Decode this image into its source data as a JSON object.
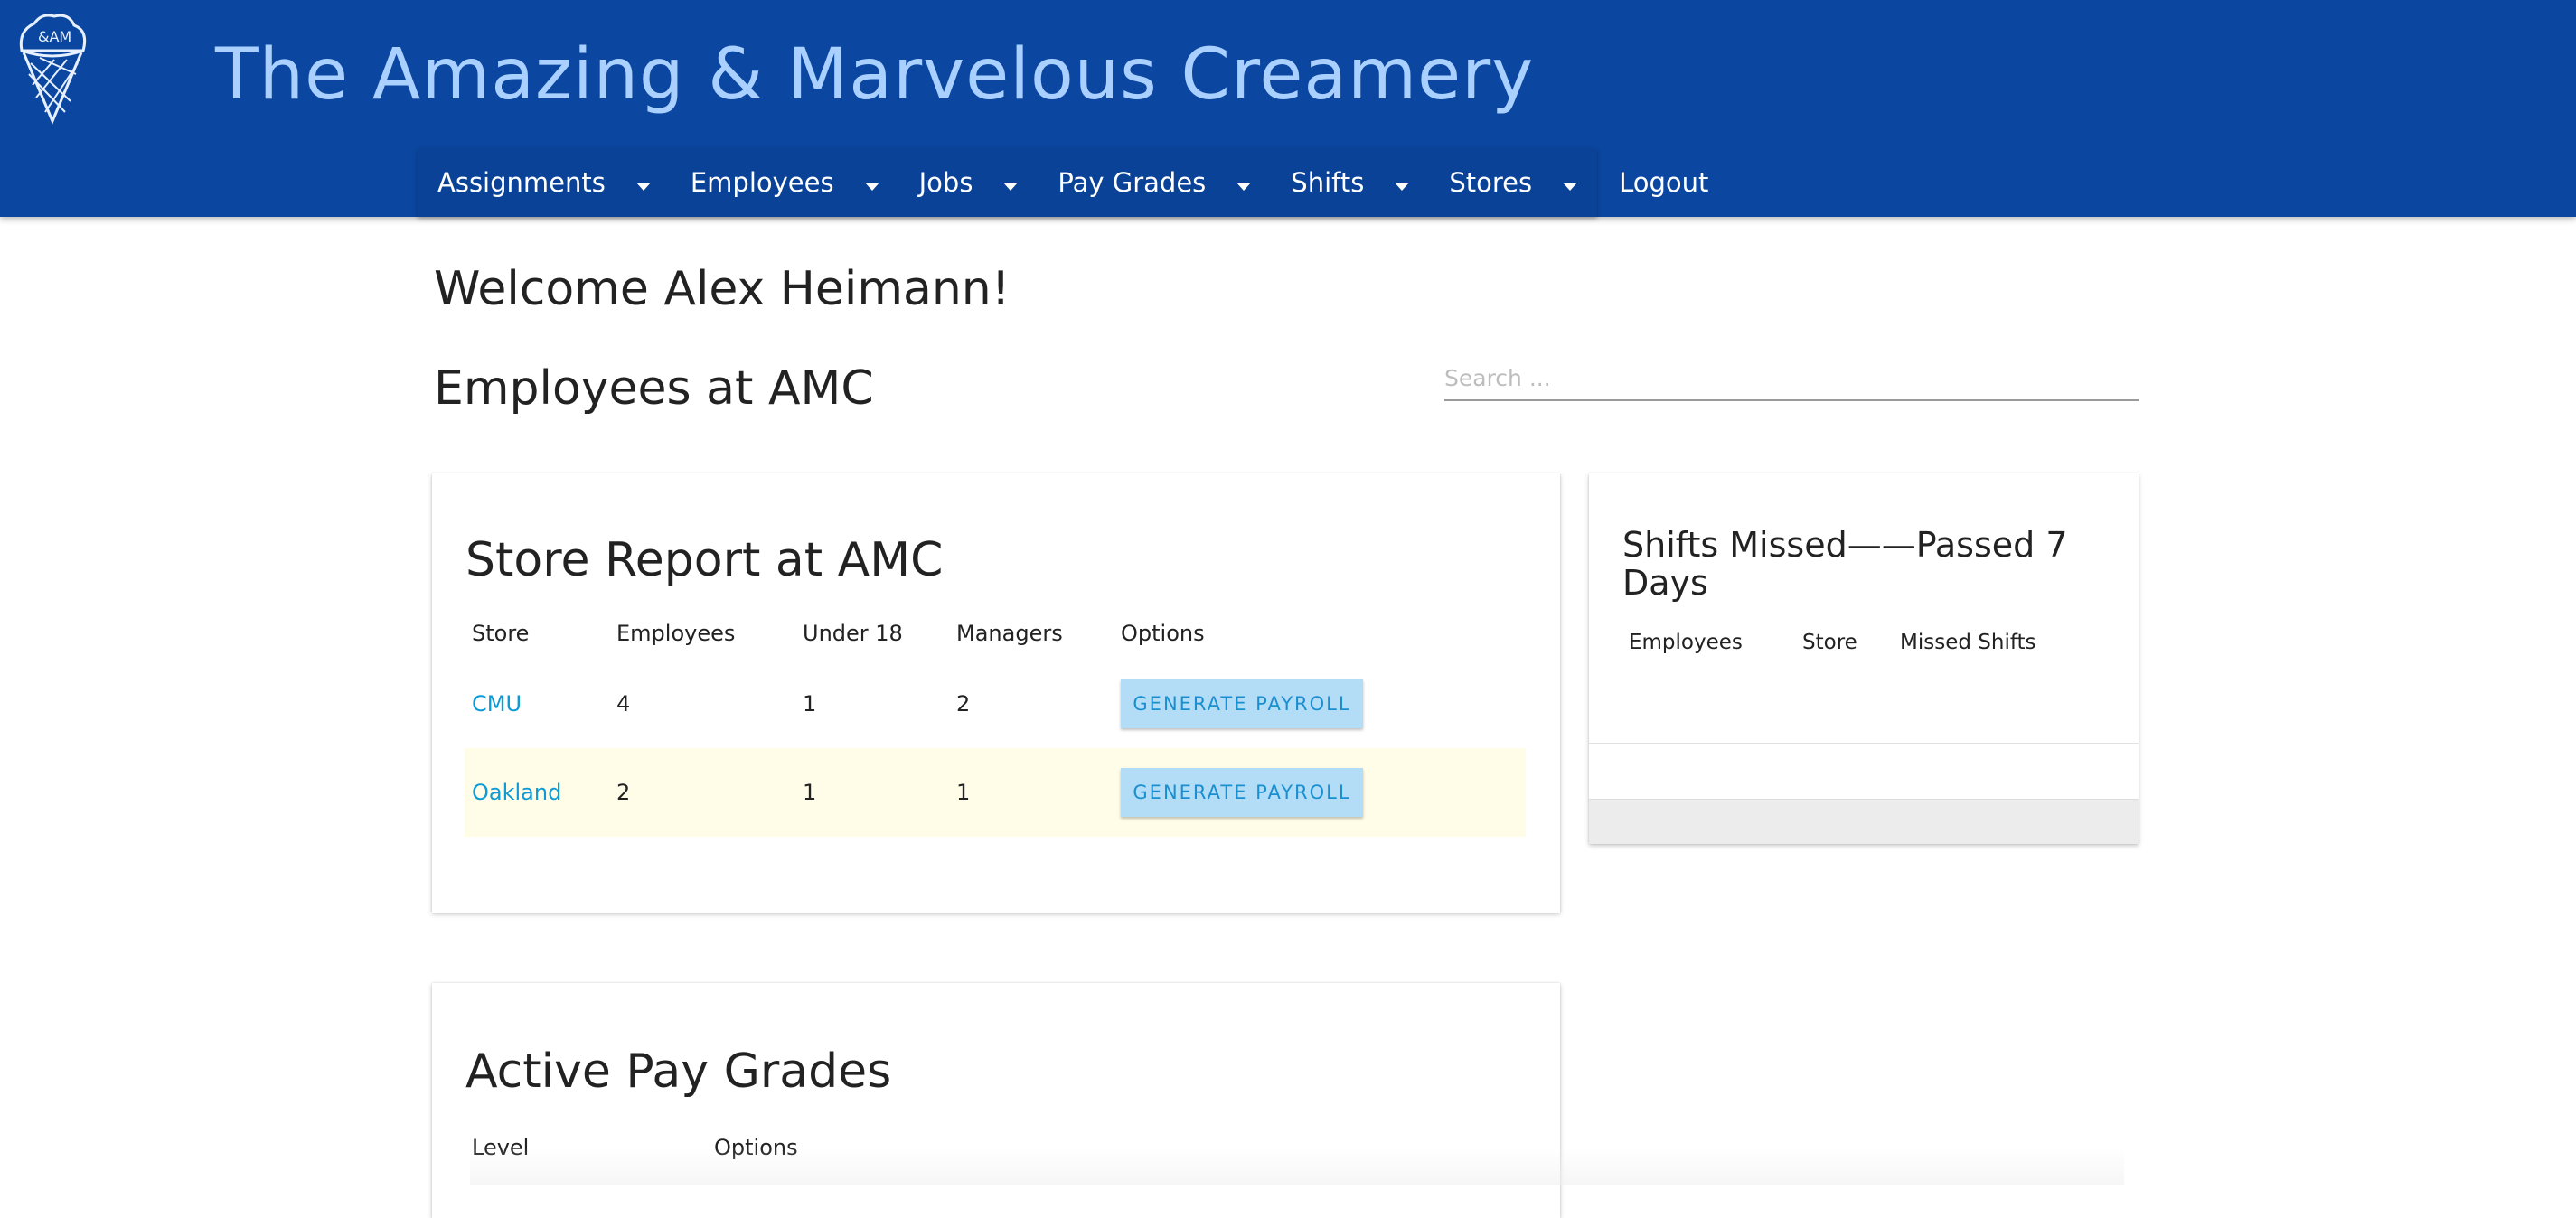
{
  "colors": {
    "brand": "#0b47a1",
    "title_text": "#a9d0ff",
    "link": "#0d9ad6",
    "button_bg": "#b3dcf6",
    "row_alt": "#fffde7"
  },
  "header": {
    "logo_icon": "ice-cream-cone-icon",
    "logo_text": "&AM",
    "title": "The Amazing & Marvelous Creamery"
  },
  "nav": {
    "items": [
      {
        "label": "Assignments",
        "dropdown": true
      },
      {
        "label": "Employees",
        "dropdown": true
      },
      {
        "label": "Jobs",
        "dropdown": true
      },
      {
        "label": "Pay Grades",
        "dropdown": true
      },
      {
        "label": "Shifts",
        "dropdown": true
      },
      {
        "label": "Stores",
        "dropdown": true
      }
    ],
    "logout": "Logout"
  },
  "main": {
    "welcome": "Welcome Alex Heimann!",
    "subtitle": "Employees at AMC",
    "search": {
      "placeholder": "Search ...",
      "value": ""
    }
  },
  "store_report": {
    "title": "Store Report at AMC",
    "columns": [
      "Store",
      "Employees",
      "Under 18",
      "Managers",
      "Options"
    ],
    "rows": [
      {
        "store": "CMU",
        "employees": "4",
        "under18": "1",
        "managers": "2",
        "action": "GENERATE PAYROLL"
      },
      {
        "store": "Oakland",
        "employees": "2",
        "under18": "1",
        "managers": "1",
        "action": "GENERATE PAYROLL"
      }
    ]
  },
  "shifts_missed": {
    "title": "Shifts Missed——Passed 7 Days",
    "columns": [
      "Employees",
      "Store",
      "Missed Shifts"
    ]
  },
  "pay_grades": {
    "title": "Active Pay Grades",
    "columns": [
      "Level",
      "Options"
    ]
  }
}
